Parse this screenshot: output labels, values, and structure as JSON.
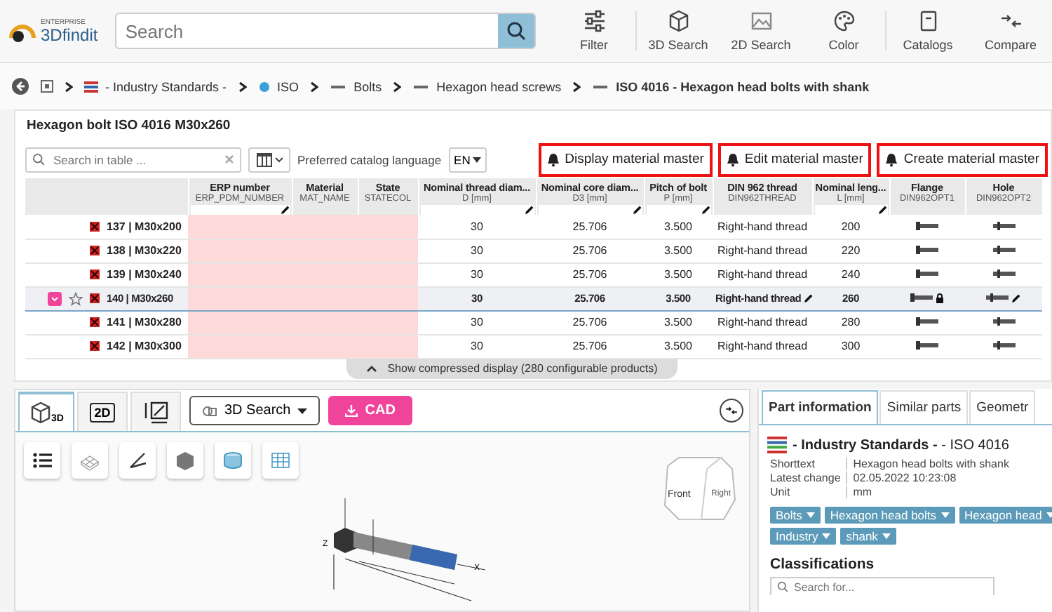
{
  "header": {
    "logo": {
      "tagline": "ENTERPRISE",
      "brand": "3Dfindit"
    },
    "search": {
      "placeholder": "Search"
    },
    "tools": [
      {
        "label": "Filter",
        "kind": "filter"
      },
      {
        "label": "3D Search",
        "kind": "cube",
        "divider": true
      },
      {
        "label": "2D Search",
        "kind": "image"
      },
      {
        "label": "Color",
        "kind": "palette"
      },
      {
        "label": "Catalogs",
        "kind": "catalog",
        "divider": true
      },
      {
        "label": "Compare",
        "kind": "compare"
      }
    ]
  },
  "breadcrumb": [
    {
      "label": "- Industry Standards -",
      "kind": "flag",
      "current": false
    },
    {
      "label": "ISO",
      "kind": "iso",
      "current": false
    },
    {
      "label": "Bolts",
      "kind": "part",
      "current": false
    },
    {
      "label": "Hexagon head screws",
      "kind": "part",
      "current": false
    },
    {
      "label": "ISO 4016 - Hexagon head bolts with shank",
      "kind": "part",
      "current": true
    }
  ],
  "table_panel": {
    "title": "Hexagon bolt ISO 4016 M30x260",
    "search": {
      "placeholder": "Search in table ..."
    },
    "language_label": "Preferred catalog language",
    "language": "EN",
    "actions": [
      {
        "label": "Display material master",
        "highlighted": true
      },
      {
        "label": "Edit material master",
        "highlighted": true
      },
      {
        "label": "Create material master",
        "highlighted": true
      }
    ],
    "columns": [
      {
        "title": "ERP number",
        "field": "ERP_PDM_NUMBER",
        "kind": "pink",
        "filter": true
      },
      {
        "title": "Material",
        "field": "MAT_NAME",
        "kind": "pink",
        "filter": false
      },
      {
        "title": "State",
        "field": "STATECOL",
        "kind": "pink",
        "filter": false
      },
      {
        "title": "Nominal thread diam...",
        "field": "D [mm]",
        "kind": "value",
        "filter": true
      },
      {
        "title": "Nominal core diam...",
        "field": "D3 [mm]",
        "kind": "value",
        "filter": true
      },
      {
        "title": "Pitch of bolt",
        "field": "P [mm]",
        "kind": "value",
        "filter": true
      },
      {
        "title": "DIN 962 thread",
        "field": "DIN962THREAD",
        "kind": "value",
        "filter": false,
        "editable": true,
        "locked": false
      },
      {
        "title": "Nominal leng...",
        "field": "L [mm]",
        "kind": "value",
        "filter": true
      },
      {
        "title": "Flange",
        "field": "DIN962OPT1",
        "kind": "flange",
        "filter": false,
        "editable": false,
        "locked": true
      },
      {
        "title": "Hole",
        "field": "DIN962OPT2",
        "kind": "hole",
        "filter": false,
        "editable": true,
        "locked": false
      }
    ],
    "rows": [
      {
        "name": "137 | M30x200",
        "selected": false,
        "values": [
          "30",
          "25.706",
          "3.500",
          "Right-hand thread",
          "200"
        ]
      },
      {
        "name": "138 | M30x220",
        "selected": false,
        "values": [
          "30",
          "25.706",
          "3.500",
          "Right-hand thread",
          "220"
        ]
      },
      {
        "name": "139 | M30x240",
        "selected": false,
        "values": [
          "30",
          "25.706",
          "3.500",
          "Right-hand thread",
          "240"
        ]
      },
      {
        "name": "140 | M30x260",
        "selected": true,
        "values": [
          "30",
          "25.706",
          "3.500",
          "Right-hand thread",
          "260"
        ]
      },
      {
        "name": "141 | M30x280",
        "selected": false,
        "values": [
          "30",
          "25.706",
          "3.500",
          "Right-hand thread",
          "280"
        ]
      },
      {
        "name": "142 | M30x300",
        "selected": false,
        "values": [
          "30",
          "25.706",
          "3.500",
          "Right-hand thread",
          "300"
        ]
      }
    ],
    "expander": "Show compressed display (280 configurable products)"
  },
  "viewer": {
    "tabs": [
      {
        "kind": "cube",
        "label": "3D",
        "selected": true
      },
      {
        "kind": "flat",
        "label": "2D",
        "selected": false
      },
      {
        "kind": "dims",
        "selected": false
      }
    ],
    "search_menu": "3D Search",
    "cad_button": "CAD",
    "tools": [
      {
        "kind": "list"
      },
      {
        "kind": "mesh"
      },
      {
        "kind": "angle"
      },
      {
        "kind": "solid"
      },
      {
        "kind": "section"
      },
      {
        "kind": "table"
      }
    ],
    "view_cube": {
      "front": "Front",
      "right": "Right"
    },
    "axes": [
      "Z",
      "X"
    ]
  },
  "info": {
    "tabs": [
      {
        "label": "Part information",
        "selected": true
      },
      {
        "label": "Similar parts",
        "selected": false
      },
      {
        "label": "Geometr",
        "selected": false
      }
    ],
    "heading": "**- Industry Standards -** - ISO 4016",
    "fields": [
      {
        "label": "Shorttext",
        "value": "Hexagon head bolts with shank"
      },
      {
        "label": "Latest change",
        "value": "02.05.2022 10:23:08"
      },
      {
        "label": "Unit",
        "value": "mm"
      }
    ],
    "tags": [
      "Bolts",
      "Hexagon head bolts",
      "Hexagon head",
      "Industry",
      "shank"
    ],
    "classifications": {
      "title": "Classifications",
      "search": {
        "placeholder": "Search for..."
      }
    }
  }
}
